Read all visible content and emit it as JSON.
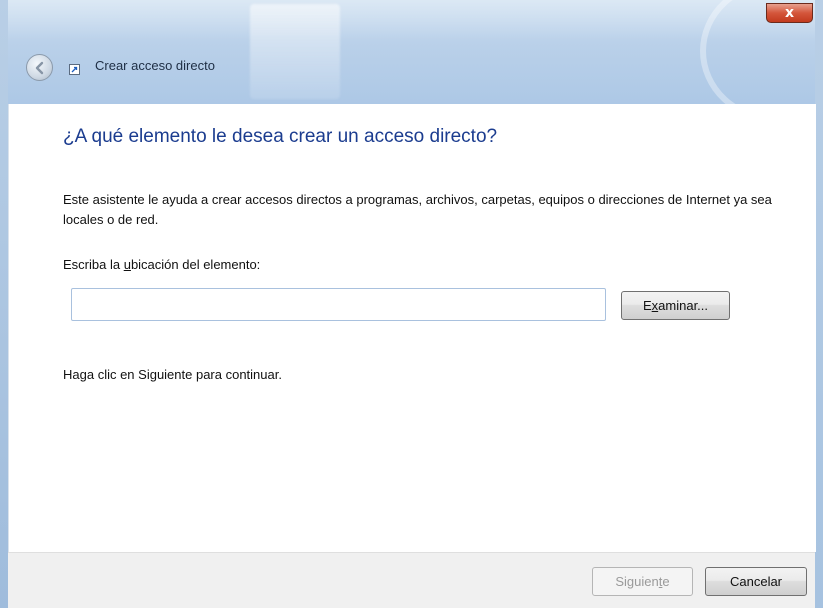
{
  "window": {
    "title": "Crear acceso directo",
    "close_glyph": "x",
    "accent_color": "#1b3c8f",
    "close_color": "#c23a1e"
  },
  "content": {
    "heading": "¿A qué elemento le desea crear un acceso directo?",
    "description": "Este asistente le ayuda a crear accesos directos a programas, archivos, carpetas, equipos o direcciones de Internet ya sea locales o de red.",
    "field_label": {
      "before": "Escriba la ",
      "mnemonic": "u",
      "after": "bicación del elemento:"
    },
    "location_value": "",
    "browse_button": {
      "before": "E",
      "mnemonic": "x",
      "after": "aminar..."
    },
    "hint": "Haga clic en Siguiente para continuar."
  },
  "footer": {
    "next_button": {
      "before": "Siguien",
      "mnemonic": "t",
      "after": "e",
      "enabled": false
    },
    "cancel_label": "Cancelar"
  },
  "icons": {
    "back": "back-arrow-icon",
    "app": "shortcut-icon",
    "close": "close-icon"
  }
}
